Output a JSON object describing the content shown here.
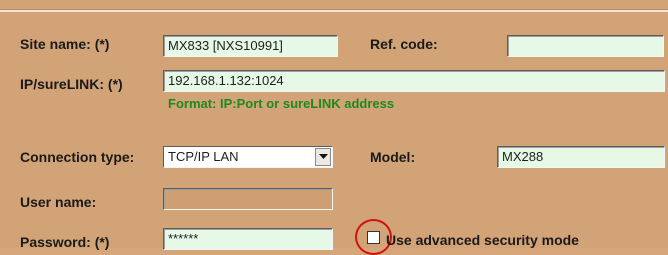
{
  "form": {
    "site_name": {
      "label": "Site name: (*)",
      "value": "MX833 [NXS10991]"
    },
    "ref_code": {
      "label": "Ref. code:",
      "value": ""
    },
    "ip": {
      "label": "IP/sureLINK: (*)",
      "value": "192.168.1.132:1024",
      "hint": "Format: IP:Port or sureLINK address"
    },
    "connection_type": {
      "label": "Connection type:",
      "value": "TCP/IP LAN"
    },
    "model": {
      "label": "Model:",
      "value": "MX288"
    },
    "user_name": {
      "label": "User name:",
      "value": ""
    },
    "password": {
      "label": "Password: (*)",
      "value": "******"
    },
    "advanced_security": {
      "label": "Use advanced security mode",
      "checked": false
    }
  },
  "colors": {
    "background": "#d3a378",
    "field_bg": "#e6f8e6",
    "hint": "#1d8a1d",
    "highlight": "#d01010"
  },
  "icons": {
    "dropdown": "chevron-down-icon"
  }
}
